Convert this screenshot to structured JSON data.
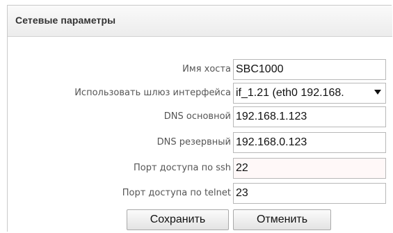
{
  "panel": {
    "title": "Сетевые параметры"
  },
  "form": {
    "fields": [
      {
        "label": "Имя хоста",
        "value": "SBC1000"
      },
      {
        "label": "Использовать шлюз интерфейса",
        "value": "if_1.21 (eth0 192.168.",
        "type": "select"
      },
      {
        "label": "DNS основной",
        "value": "192.168.1.123"
      },
      {
        "label": "DNS резервный",
        "value": "192.168.0.123"
      },
      {
        "label": "Порт доступа по ssh",
        "value": "22"
      },
      {
        "label": "Порт доступа по telnet",
        "value": "23"
      }
    ]
  },
  "buttons": {
    "save": "Сохранить",
    "cancel": "Отменить"
  }
}
